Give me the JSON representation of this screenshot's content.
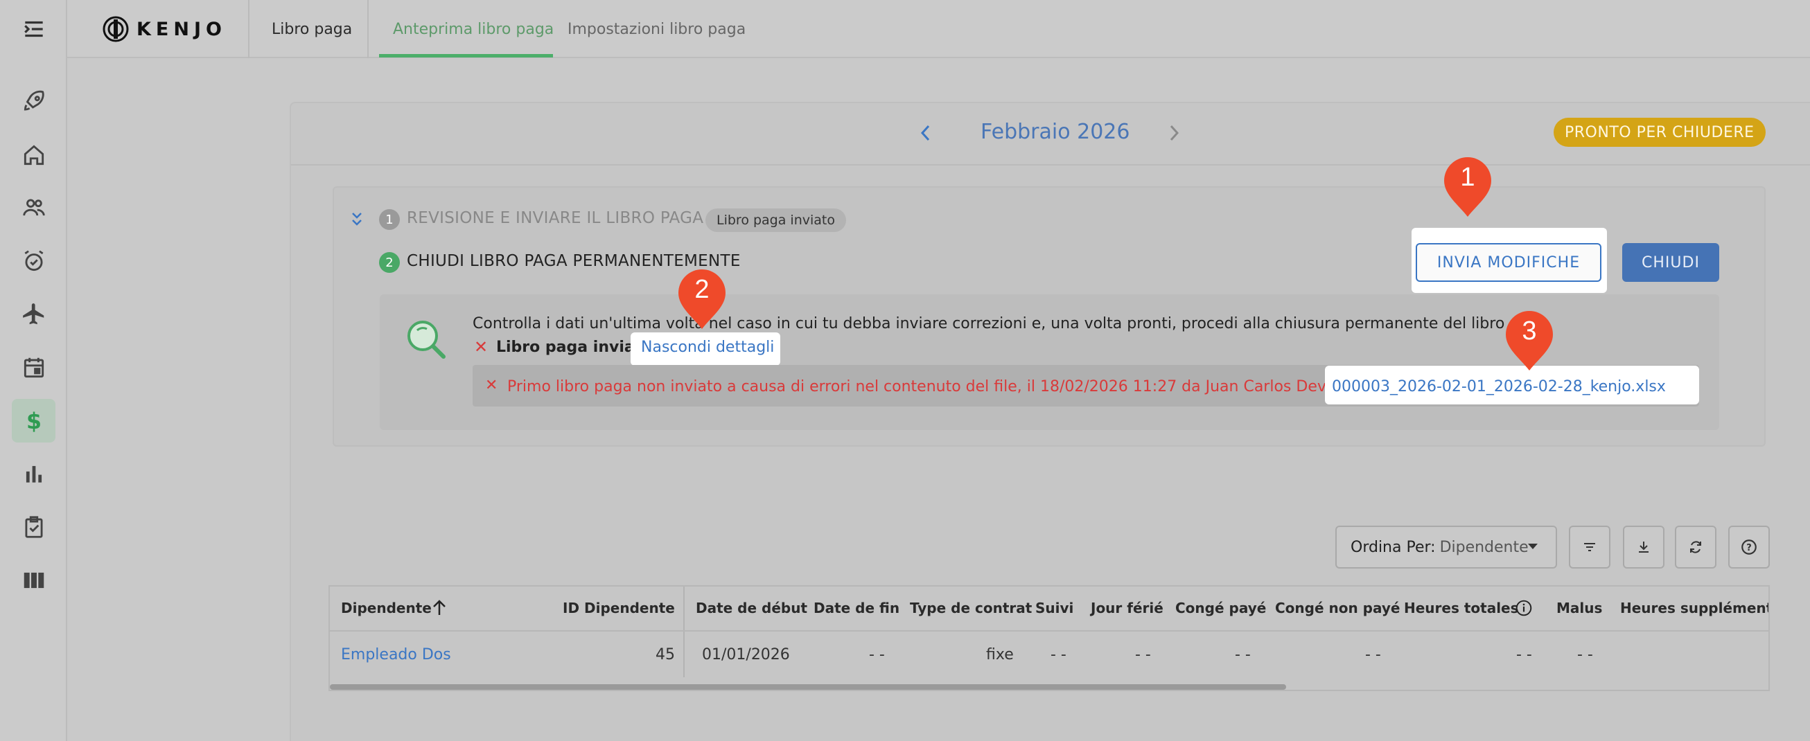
{
  "topbar": {
    "logo_text": "KENJO",
    "tabs": [
      {
        "label": "Libro paga"
      },
      {
        "label": "Anteprima libro paga"
      },
      {
        "label": "Impostazioni libro paga"
      }
    ]
  },
  "sidebar": {
    "items": [
      {
        "icon": "menu-collapse-icon"
      },
      {
        "icon": "rocket-icon"
      },
      {
        "icon": "home-icon"
      },
      {
        "icon": "people-icon"
      },
      {
        "icon": "alarm-check-icon"
      },
      {
        "icon": "airplane-icon"
      },
      {
        "icon": "calendar-icon"
      },
      {
        "icon": "dollar-icon"
      },
      {
        "icon": "bar-chart-icon"
      },
      {
        "icon": "clipboard-check-icon"
      },
      {
        "icon": "columns-icon"
      }
    ]
  },
  "header": {
    "month": "Febbraio 2026",
    "status": "PRONTO PER CHIUDERE"
  },
  "steps": {
    "step1": {
      "number": "1",
      "title": "REVISIONE E INVIARE IL LIBRO PAGA",
      "chip": "Libro paga inviato"
    },
    "step2": {
      "number": "2",
      "title": "CHIUDI LIBRO PAGA PERMANENTEMENTE"
    },
    "send_button": "INVIA MODIFICHE",
    "close_button": "CHIUDI"
  },
  "info": {
    "message": "Controlla i dati un'ultima volta nel caso in cui tu debba inviare correzioni e, una volta pronti, procedi alla chiusura permanente del libro paga.",
    "status_label": "Libro paga inviato",
    "toggle_link": "Nascondi dettagli",
    "error_text": "Primo libro paga non inviato a causa di errori nel contenuto del file, il 18/02/2026 11:27 da Juan Carlos Dev1",
    "file_link": "000003_2026-02-01_2026-02-28_kenjo.xlsx"
  },
  "annotations": [
    "1",
    "2",
    "3"
  ],
  "toolbar": {
    "sort_label": "Ordina Per:",
    "sort_value": "Dipendente"
  },
  "table": {
    "headers": [
      "Dipendente",
      "ID Dipendente",
      "Date de début",
      "Date de fin",
      "Type de contrat",
      "Suivi",
      "Jour férié",
      "Congé payé",
      "Congé non payé",
      "Heures totales",
      "Malus",
      "Heures supplémentaire"
    ],
    "row": {
      "name": "Empleado Dos",
      "id": "45",
      "start": "01/01/2026",
      "end": "- -",
      "contract": "fixe",
      "suivi": "- -",
      "jour_ferie": "- -",
      "conge_paye": "- -",
      "conge_non_paye": "- -",
      "heures_totales": "- -",
      "malus": "- -"
    }
  },
  "colors": {
    "accent_blue": "#3a76c4",
    "pin_red": "#ef4a2a",
    "status_yellow": "#d4a416",
    "success_green": "#4cae6a",
    "error_red": "#d93a3a"
  }
}
